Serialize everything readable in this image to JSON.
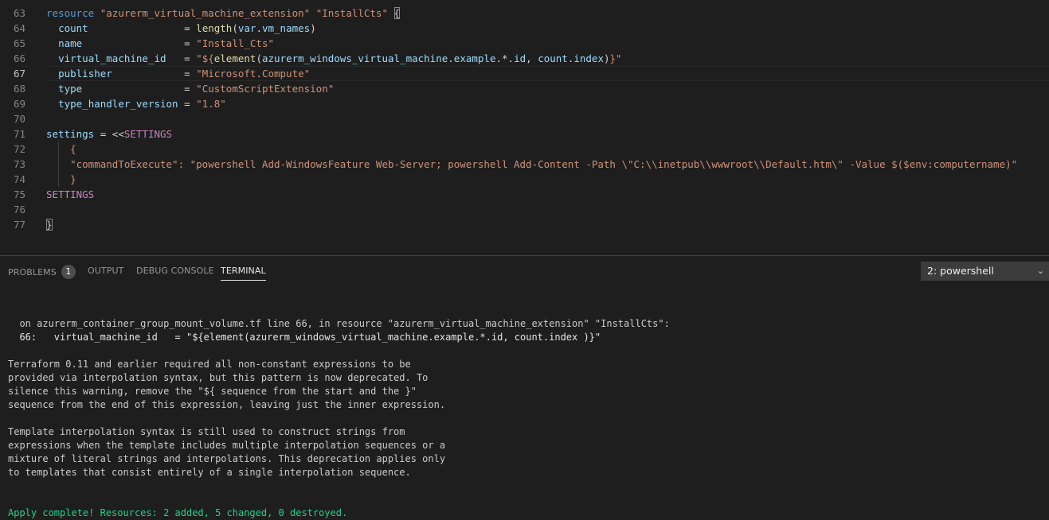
{
  "editor": {
    "lines": [
      {
        "n": "63",
        "segs": [
          {
            "c": "tk-kw",
            "t": "resource"
          },
          {
            "c": "tk-op",
            "t": " "
          },
          {
            "c": "tk-str",
            "t": "\"azurerm_virtual_machine_extension\""
          },
          {
            "c": "tk-op",
            "t": " "
          },
          {
            "c": "tk-str",
            "t": "\"InstallCts\""
          },
          {
            "c": "tk-op",
            "t": " "
          },
          {
            "c": "tk-bracket",
            "t": "{"
          }
        ]
      },
      {
        "n": "64",
        "segs": [
          {
            "c": "tk-op",
            "t": "  "
          },
          {
            "c": "tk-ident",
            "t": "count"
          },
          {
            "c": "tk-op",
            "t": "                = "
          },
          {
            "c": "tk-fn",
            "t": "length"
          },
          {
            "c": "tk-punc",
            "t": "("
          },
          {
            "c": "tk-ident",
            "t": "var"
          },
          {
            "c": "tk-punc",
            "t": "."
          },
          {
            "c": "tk-ident",
            "t": "vm_names"
          },
          {
            "c": "tk-punc",
            "t": ")"
          }
        ]
      },
      {
        "n": "65",
        "segs": [
          {
            "c": "tk-op",
            "t": "  "
          },
          {
            "c": "tk-ident",
            "t": "name"
          },
          {
            "c": "tk-op",
            "t": "                 = "
          },
          {
            "c": "tk-str",
            "t": "\"Install_Cts\""
          }
        ]
      },
      {
        "n": "66",
        "segs": [
          {
            "c": "tk-op",
            "t": "  "
          },
          {
            "c": "tk-ident",
            "t": "virtual_machine_id"
          },
          {
            "c": "tk-op",
            "t": "   = "
          },
          {
            "c": "tk-str",
            "t": "\"${"
          },
          {
            "c": "tk-fn",
            "t": "element"
          },
          {
            "c": "tk-punc",
            "t": "("
          },
          {
            "c": "tk-ident",
            "t": "azurerm_windows_virtual_machine"
          },
          {
            "c": "tk-punc",
            "t": "."
          },
          {
            "c": "tk-ident",
            "t": "example"
          },
          {
            "c": "tk-punc",
            "t": ".*."
          },
          {
            "c": "tk-ident",
            "t": "id"
          },
          {
            "c": "tk-punc",
            "t": ", "
          },
          {
            "c": "tk-ident",
            "t": "count"
          },
          {
            "c": "tk-punc",
            "t": "."
          },
          {
            "c": "tk-ident",
            "t": "index"
          },
          {
            "c": "tk-punc",
            "t": ")"
          },
          {
            "c": "tk-str",
            "t": "}\""
          }
        ]
      },
      {
        "n": "67",
        "active": true,
        "segs": [
          {
            "c": "tk-op",
            "t": "  "
          },
          {
            "c": "tk-ident",
            "t": "publisher"
          },
          {
            "c": "tk-op",
            "t": "            = "
          },
          {
            "c": "tk-str",
            "t": "\"Microsoft.Compute\""
          }
        ]
      },
      {
        "n": "68",
        "segs": [
          {
            "c": "tk-op",
            "t": "  "
          },
          {
            "c": "tk-ident",
            "t": "type"
          },
          {
            "c": "tk-op",
            "t": "                 = "
          },
          {
            "c": "tk-str",
            "t": "\"CustomScriptExtension\""
          }
        ]
      },
      {
        "n": "69",
        "segs": [
          {
            "c": "tk-op",
            "t": "  "
          },
          {
            "c": "tk-ident",
            "t": "type_handler_version"
          },
          {
            "c": "tk-op",
            "t": " = "
          },
          {
            "c": "tk-str",
            "t": "\"1.8\""
          }
        ]
      },
      {
        "n": "70",
        "segs": []
      },
      {
        "n": "71",
        "segs": [
          {
            "c": "tk-ident",
            "t": "settings"
          },
          {
            "c": "tk-op",
            "t": " = "
          },
          {
            "c": "tk-op",
            "t": "<<"
          },
          {
            "c": "tk-heredoc",
            "t": "SETTINGS"
          }
        ]
      },
      {
        "n": "72",
        "segs": [
          {
            "c": "tk-op",
            "t": "    "
          },
          {
            "c": "tk-str",
            "t": "{"
          }
        ]
      },
      {
        "n": "73",
        "segs": [
          {
            "c": "tk-op",
            "t": "    "
          },
          {
            "c": "tk-str",
            "t": "\"commandToExecute\": \"powershell Add-WindowsFeature Web-Server; powershell Add-Content -Path \\\"C:\\\\inetpub\\\\wwwroot\\\\Default.htm\\\" -Value $($env:computername)\""
          }
        ]
      },
      {
        "n": "74",
        "segs": [
          {
            "c": "tk-op",
            "t": "    "
          },
          {
            "c": "tk-str",
            "t": "}"
          }
        ]
      },
      {
        "n": "75",
        "segs": [
          {
            "c": "tk-heredoc",
            "t": "SETTINGS"
          }
        ]
      },
      {
        "n": "76",
        "segs": []
      },
      {
        "n": "77",
        "segs": [
          {
            "c": "tk-bracket",
            "t": "}"
          }
        ]
      }
    ]
  },
  "panel": {
    "tabs": [
      {
        "label": "PROBLEMS",
        "badge": "1",
        "active": false
      },
      {
        "label": "OUTPUT",
        "active": false
      },
      {
        "label": "DEBUG CONSOLE",
        "active": false
      },
      {
        "label": "TERMINAL",
        "active": true
      }
    ],
    "terminal_selector": "2: powershell"
  },
  "terminal": {
    "lines": [
      {
        "t": "",
        "cls": "gap"
      },
      {
        "t": "  on azurerm_container_group_mount_volume.tf line 66, in resource \"azurerm_virtual_machine_extension\" \"InstallCts\":"
      },
      {
        "t": "  66:   virtual_machine_id   = \"${element(azurerm_windows_virtual_machine.example.*.id, count.index )}\"",
        "cls": "bold"
      },
      {
        "t": "",
        "cls": "gap"
      },
      {
        "t": "Terraform 0.11 and earlier required all non-constant expressions to be"
      },
      {
        "t": "provided via interpolation syntax, but this pattern is now deprecated. To"
      },
      {
        "t": "silence this warning, remove the \"${ sequence from the start and the }\""
      },
      {
        "t": "sequence from the end of this expression, leaving just the inner expression."
      },
      {
        "t": "",
        "cls": "gap"
      },
      {
        "t": "Template interpolation syntax is still used to construct strings from"
      },
      {
        "t": "expressions when the template includes multiple interpolation sequences or a"
      },
      {
        "t": "mixture of literal strings and interpolations. This deprecation applies only"
      },
      {
        "t": "to templates that consist entirely of a single interpolation sequence."
      },
      {
        "t": "",
        "cls": "gap"
      },
      {
        "t": "",
        "cls": "gap"
      },
      {
        "t": "Apply complete! Resources: 2 added, 5 changed, 0 destroyed.",
        "cls": "green"
      }
    ]
  },
  "colors": {
    "background": "#1e1e1e",
    "keyword": "#569cd6",
    "string": "#ce9178",
    "identifier": "#9cdcfe",
    "function": "#dcdcaa",
    "heredoc": "#c586c0",
    "success": "#23d18b"
  }
}
